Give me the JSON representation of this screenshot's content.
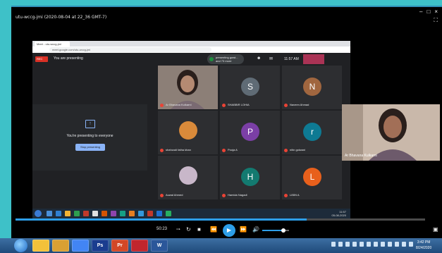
{
  "player": {
    "title": "utu-wccg-jmi (2020-08-04 at 22_36 GMT-7)",
    "window_controls": [
      "–",
      "□",
      "×"
    ],
    "fullscreen_icon": "⛶"
  },
  "chrome": {
    "tab_title": "Meet - utu-wccg-jmi",
    "url": "meet.google.com/utu-wccg-jmi"
  },
  "meet": {
    "rec_label": "REC",
    "presenting_label": "You are presenting",
    "present_chip": "presenting gowt... and 73 more",
    "clock": "11:57 AM",
    "people_count": "76",
    "present_panel": {
      "message": "You're presenting to everyone",
      "stop_button": "Stop presenting"
    },
    "participants": [
      {
        "name": "Ar Bhavana Kulkarni",
        "type": "photo",
        "color": "#b58a72"
      },
      {
        "name": "SHABBIR LOHIA",
        "type": "letter",
        "letter": "S",
        "color": "#5f6b75"
      },
      {
        "name": "Naveen Ahmad",
        "type": "letter",
        "letter": "N",
        "color": "#a0663f"
      },
      {
        "name": "shahzadi fatha khan",
        "type": "photo-circle",
        "color": "#d98a3a"
      },
      {
        "name": "Pooja A",
        "type": "letter",
        "letter": "P",
        "color": "#7b3fa6"
      },
      {
        "name": "nitin golwani",
        "type": "letter",
        "letter": "r",
        "color": "#0e7a93"
      },
      {
        "name": "Auwal Ahmed",
        "type": "photo-circle",
        "color": "#c8b7c9"
      },
      {
        "name": "Hamida Nagadi",
        "type": "letter",
        "letter": "H",
        "color": "#137a70"
      },
      {
        "name": "LIBIN A",
        "type": "letter",
        "letter": "L",
        "color": "#e8601c"
      }
    ],
    "taskbar_clock": "11:57",
    "taskbar_date": "05-08-2020"
  },
  "side_feed": {
    "name": "Ar Bhavana Kulkarni"
  },
  "controls": {
    "time": "50:23",
    "progress": 0.71,
    "volume": 0.78,
    "icons": {
      "loop": "⭬",
      "shuffle": "↻",
      "stop": "■",
      "rewind": "⏪",
      "play": "▶",
      "forward": "⏩",
      "volume": "🔊",
      "pip": "▣"
    }
  },
  "taskbar": {
    "apps": [
      "",
      "",
      "",
      "Ps",
      "Pr",
      "",
      "W"
    ],
    "time": "3:42 PM",
    "date": "8/24/2020",
    "accent": "#2d9ee8"
  }
}
